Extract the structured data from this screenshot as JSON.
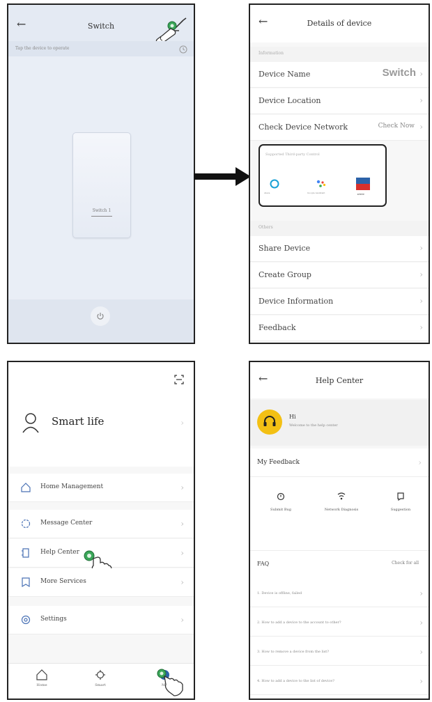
{
  "panel1": {
    "title": "Switch",
    "subtitle": "Tap the device to operate",
    "switch_label": "Switch 1"
  },
  "panel2": {
    "title": "Details of device",
    "section_info": "Information",
    "device_name_label": "Device Name",
    "device_name_value": "Switch",
    "device_location_label": "Device Location",
    "check_network_label": "Check Device Network",
    "check_network_value": "Check Now",
    "third_party_label": "Supported Third-party Control",
    "alexa_label": "Alexa",
    "google_label": "Google Assistant",
    "ifttt_label": "IFTTT",
    "section_others": "Others",
    "share_device": "Share Device",
    "create_group": "Create Group",
    "device_information": "Device Information",
    "feedback": "Feedback"
  },
  "panel3": {
    "profile_name": "Smart life",
    "home_management": "Home Management",
    "message_center": "Message Center",
    "help_center": "Help Center",
    "more_services": "More Services",
    "settings": "Settings",
    "nav_home": "Home",
    "nav_smart": "Smart",
    "nav_me": "Me"
  },
  "panel4": {
    "title": "Help Center",
    "agent_name": "Hi",
    "agent_sub": "Welcome to the help center",
    "my_feedback": "My Feedback",
    "action1": "Submit Bug",
    "action2": "Network Diagnosis",
    "action3": "Suggestion",
    "faq": "FAQ",
    "faq_more": "Check for all",
    "q1": "1. Device is offline, failed",
    "q2": "2. How to add a device to the account to other?",
    "q3": "3. How to remove a device from the list?",
    "q4": "4. How to add a device to the list of device?"
  },
  "colors": {
    "switch_green": "#3aa659",
    "agent_yellow": "#f3c014",
    "alexa_blue": "#18a0d5",
    "ifttt_blue": "#2c62a8",
    "ifttt_red": "#d7302c"
  }
}
